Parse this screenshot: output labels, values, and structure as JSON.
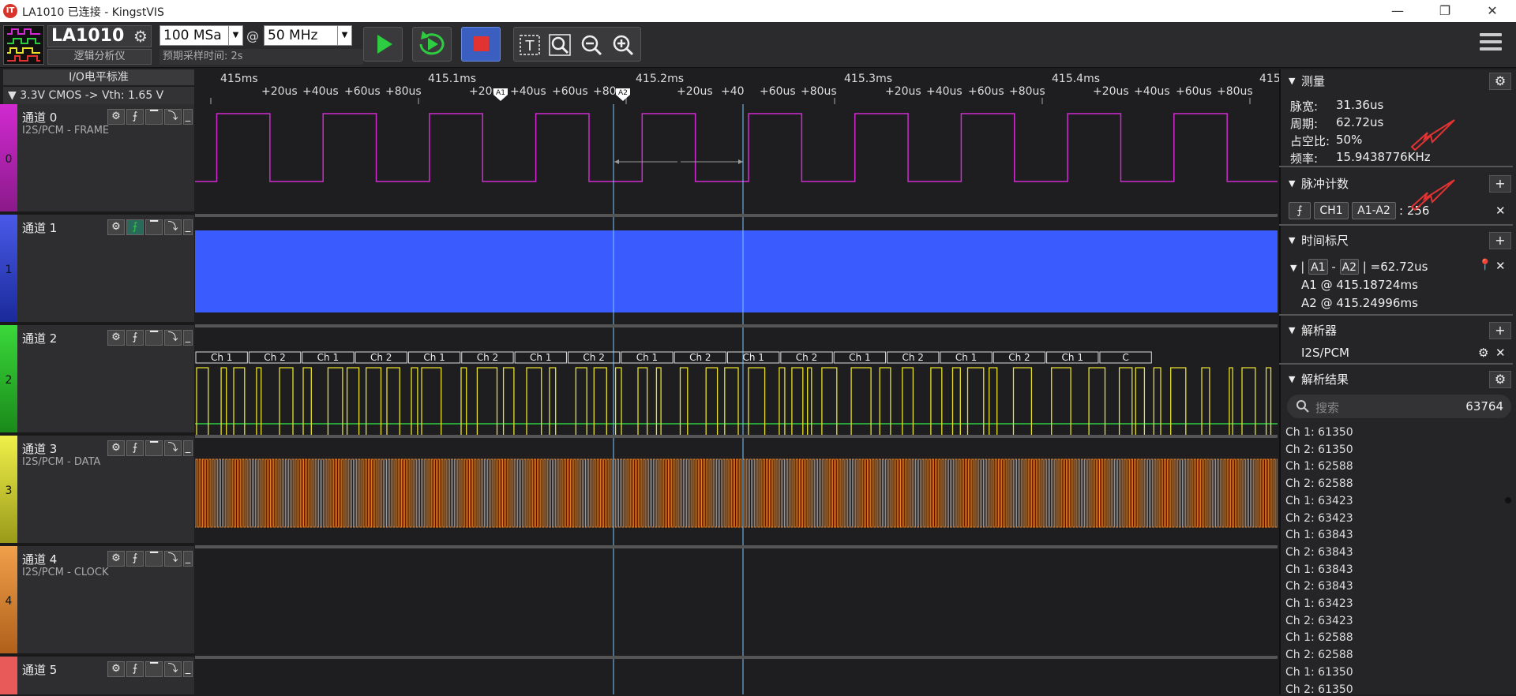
{
  "window": {
    "title": "LA1010 已连接 - KingstVIS",
    "logo_text": "IT",
    "controls": [
      "—",
      "❐",
      "✕"
    ]
  },
  "toolbar": {
    "device_name": "LA1010",
    "device_subtitle": "逻辑分析仪",
    "sample_rate": "100 MSa",
    "at_sign": "@",
    "frequency": "50 MHz",
    "estimated_time": "预期采样时间: 2s",
    "colors": {
      "start": "#2ecc40",
      "repeat": "#2ecc40",
      "stop": "#e33232"
    }
  },
  "left_header": {
    "io_label": "I/O电平标准",
    "level": "▼ 3.3V CMOS  -> Vth: 1.65 V"
  },
  "ruler": {
    "major": [
      "415ms",
      "415.1ms",
      "415.2ms",
      "415.3ms",
      "415.4ms",
      "415"
    ],
    "minor": [
      "+20us",
      "+40us",
      "+60us",
      "+80us",
      "+20us",
      "+40us",
      "+60us",
      "+80us",
      "+20us",
      "+40",
      "+60us",
      "+80us",
      "+20us",
      "+40us",
      "+60us",
      "+80us",
      "+20us",
      "+40us",
      "+60us",
      "+80us"
    ],
    "cursor_a1": "A1",
    "cursor_a2": "A2"
  },
  "channels": [
    {
      "num": "0",
      "name": "通道 0",
      "sub": "I2S/PCM - FRAME",
      "color": "#c02ccf"
    },
    {
      "num": "1",
      "name": "通道 1",
      "sub": "",
      "color": "#3040c8"
    },
    {
      "num": "2",
      "name": "通道 2",
      "sub": "",
      "color": "#26b82e"
    },
    {
      "num": "3",
      "name": "通道 3",
      "sub": "I2S/PCM - DATA",
      "color": "#e8e82c"
    },
    {
      "num": "4",
      "name": "通道 4",
      "sub": "I2S/PCM - CLOCK",
      "color": "#e88a2c"
    },
    {
      "num": "5",
      "name": "通道 5",
      "sub": "",
      "color": "#e84a4a"
    }
  ],
  "channel_buttons": [
    "⚙",
    "⨍",
    "▔",
    "⤵",
    "_"
  ],
  "data_labels": [
    "Ch 1",
    "Ch 2",
    "Ch 1",
    "Ch 2",
    "Ch 1",
    "Ch 2",
    "Ch 1",
    "Ch 2",
    "Ch 1",
    "Ch 2",
    "Ch 1",
    "Ch 2",
    "Ch 1",
    "Ch 2",
    "Ch 1",
    "Ch 2",
    "Ch 1",
    "C"
  ],
  "wave_colors": {
    "frame": "#d12ad1",
    "ch1_fill": "#3a5cff",
    "ch2_line": "#2ecc40",
    "data": "#e8e02c",
    "clock": "#e8862c",
    "cursor": "#7ec8ff"
  },
  "panel": {
    "measure": {
      "title": "测量",
      "rows": [
        {
          "label": "脉宽:",
          "value": "31.36us"
        },
        {
          "label": "周期:",
          "value": "62.72us"
        },
        {
          "label": "占空比:",
          "value": "50%"
        },
        {
          "label": "频率:",
          "value": "15.9438776KHz"
        }
      ]
    },
    "pulse": {
      "title": "脉冲计数",
      "channel": "CH1",
      "range": "A1-A2",
      "count": ": 256"
    },
    "timemark": {
      "title": "时间标尺",
      "delta_a1": "A1",
      "delta_sep": "-",
      "delta_a2": "A2",
      "delta_value": "=62.72us",
      "a1": "A1 @ 415.18724ms",
      "a2": "A2 @ 415.24996ms"
    },
    "decoder": {
      "title": "解析器",
      "name": "I2S/PCM"
    },
    "results": {
      "title": "解析结果",
      "search_placeholder": "搜索",
      "count": "63764",
      "items": [
        "Ch 1: 61350",
        "Ch 2: 61350",
        "Ch 1: 62588",
        "Ch 2: 62588",
        "Ch 1: 63423",
        "Ch 2: 63423",
        "Ch 1: 63843",
        "Ch 2: 63843",
        "Ch 1: 63843",
        "Ch 2: 63843",
        "Ch 1: 63423",
        "Ch 2: 63423",
        "Ch 1: 62588",
        "Ch 2: 62588",
        "Ch 1: 61350",
        "Ch 2: 61350"
      ]
    }
  }
}
